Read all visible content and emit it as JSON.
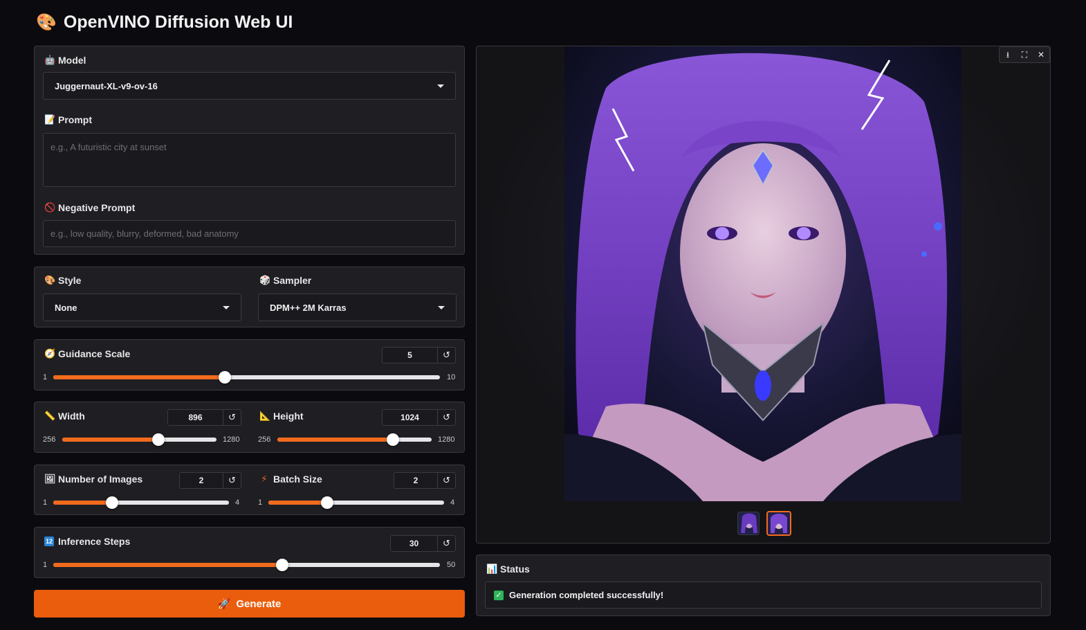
{
  "app": {
    "title": "OpenVINO Diffusion Web UI",
    "title_icon": "palette-icon"
  },
  "model": {
    "label": "Model",
    "icon": "robot-icon",
    "value": "Juggernaut-XL-v9-ov-16"
  },
  "prompt": {
    "label": "Prompt",
    "icon": "memo-icon",
    "placeholder": "e.g., A futuristic city at sunset",
    "value": ""
  },
  "negative_prompt": {
    "label": "Negative Prompt",
    "icon": "prohibited-icon",
    "placeholder": "e.g., low quality, blurry, deformed, bad anatomy",
    "value": ""
  },
  "style": {
    "label": "Style",
    "icon": "palette-icon",
    "value": "None"
  },
  "sampler": {
    "label": "Sampler",
    "icon": "dice-icon",
    "value": "DPM++ 2M Karras"
  },
  "guidance_scale": {
    "label": "Guidance Scale",
    "icon": "compass-icon",
    "value": "5",
    "min": "1",
    "max": "10",
    "fraction": 0.444
  },
  "width": {
    "label": "Width",
    "icon": "ruler-icon",
    "value": "896",
    "min": "256",
    "max": "1280",
    "fraction": 0.625
  },
  "height": {
    "label": "Height",
    "icon": "triangle-ruler-icon",
    "value": "1024",
    "min": "256",
    "max": "1280",
    "fraction": 0.75
  },
  "num_images": {
    "label": "Number of Images",
    "icon": "picture-icon",
    "value": "2",
    "min": "1",
    "max": "4",
    "fraction": 0.333
  },
  "batch_size": {
    "label": "Batch Size",
    "icon": "lightning-icon",
    "value": "2",
    "min": "1",
    "max": "4",
    "fraction": 0.333
  },
  "inference_steps": {
    "label": "Inference Steps",
    "icon": "numbers-icon",
    "value": "30",
    "min": "1",
    "max": "50",
    "fraction": 0.592
  },
  "reset_symbol": "↺",
  "generate": {
    "label": "Generate",
    "icon": "rocket-icon"
  },
  "gallery": {
    "tools": [
      "download-icon",
      "fullscreen-icon",
      "close-icon"
    ],
    "thumbnail_count": 2,
    "selected_index": 1
  },
  "status": {
    "label": "Status",
    "icon": "bar-chart-icon",
    "message": "Generation completed successfully!"
  },
  "colors": {
    "accent": "#e95d0c",
    "slider_fill": "#f26b1d",
    "success": "#2fb45a"
  }
}
